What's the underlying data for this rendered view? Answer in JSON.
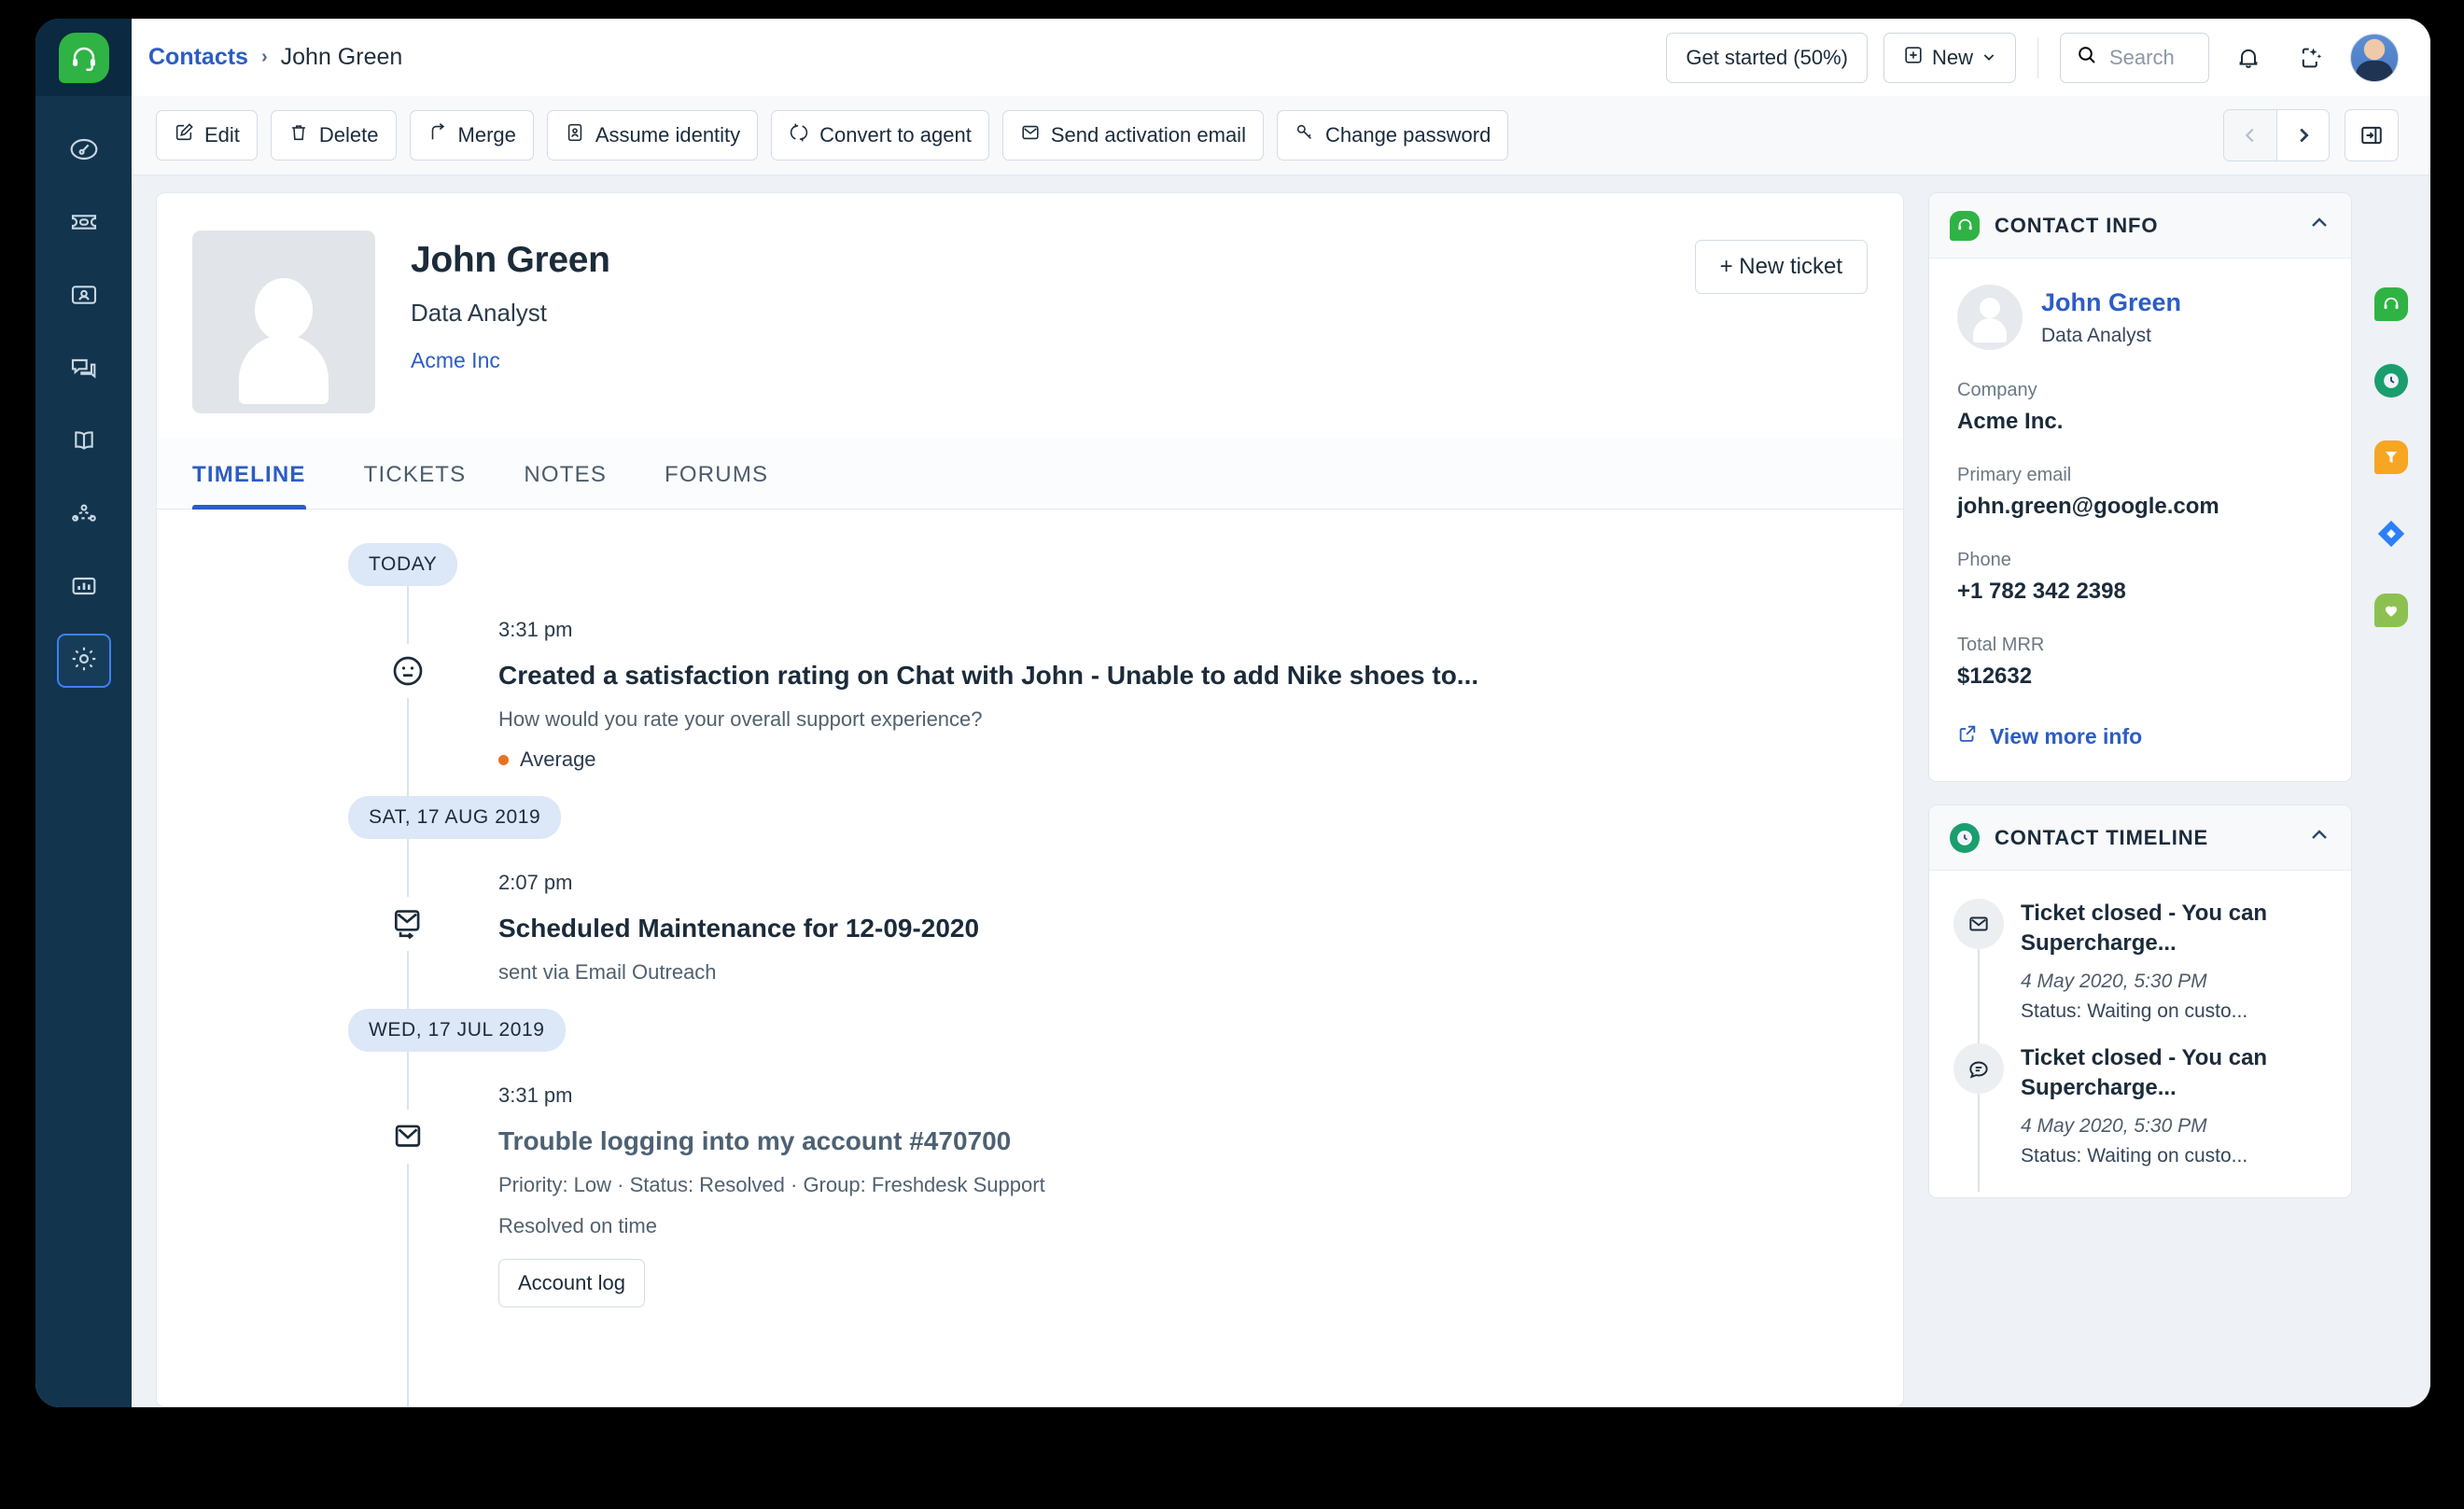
{
  "leftnav": {
    "logo_icon": "headset-icon",
    "items": [
      {
        "name": "dashboard",
        "icon": "speedometer-icon"
      },
      {
        "name": "tickets",
        "icon": "ticket-icon"
      },
      {
        "name": "contacts",
        "icon": "contact-card-icon"
      },
      {
        "name": "chat",
        "icon": "chat-bubbles-icon"
      },
      {
        "name": "solutions",
        "icon": "book-icon"
      },
      {
        "name": "automations",
        "icon": "nodes-icon"
      },
      {
        "name": "analytics",
        "icon": "bar-chart-icon"
      },
      {
        "name": "admin",
        "icon": "gear-icon",
        "active": true
      }
    ]
  },
  "header": {
    "breadcrumb_root": "Contacts",
    "breadcrumb_separator": "›",
    "breadcrumb_current": "John Green",
    "get_started_label": "Get started (50%)",
    "new_label": "New",
    "new_caret": "⌄",
    "search_placeholder": "Search",
    "notifications_icon": "bell-icon",
    "freddy_icon": "sparkle-icon",
    "avatar_icon": "user-avatar"
  },
  "toolbar": {
    "buttons": [
      {
        "label": "Edit",
        "icon": "pencil-square-icon"
      },
      {
        "label": "Delete",
        "icon": "trash-icon"
      },
      {
        "label": "Merge",
        "icon": "merge-arrow-icon"
      },
      {
        "label": "Assume identity",
        "icon": "id-badge-icon"
      },
      {
        "label": "Convert to agent",
        "icon": "refresh-icon"
      },
      {
        "label": "Send activation email",
        "icon": "envelope-check-icon"
      },
      {
        "label": "Change password",
        "icon": "key-icon"
      }
    ],
    "prev_arrow": "‹",
    "next_arrow": "›",
    "panel_toggle_icon": "panel-collapse-icon"
  },
  "contact": {
    "name": "John Green",
    "role": "Data Analyst",
    "company": "Acme Inc",
    "new_ticket_label": "+ New ticket"
  },
  "tabs": [
    {
      "label": "TIMELINE",
      "active": true
    },
    {
      "label": "TICKETS",
      "active": false
    },
    {
      "label": "NOTES",
      "active": false
    },
    {
      "label": "FORUMS",
      "active": false
    }
  ],
  "timeline": [
    {
      "date_pill": "TODAY",
      "entries": [
        {
          "time": "3:31 pm",
          "title": "Created a satisfaction rating on Chat with John - Unable to add Nike shoes to...",
          "icon": "neutral-face-icon",
          "subtitle": "How would you rate your overall support experience?",
          "rating": "Average",
          "rating_color": "#e8731e",
          "muted": false
        }
      ]
    },
    {
      "date_pill": "SAT, 17 AUG 2019",
      "entries": [
        {
          "time": "2:07 pm",
          "title": "Scheduled Maintenance for 12-09-2020",
          "icon": "envelope-outreach-icon",
          "subtitle": "sent via Email Outreach",
          "muted": false
        }
      ]
    },
    {
      "date_pill": "WED, 17 JUL 2019",
      "entries": [
        {
          "time": "3:31 pm",
          "title": "Trouble logging into my account #470700",
          "icon": "envelope-icon",
          "subtitle": "Priority: Low  ·  Status: Resolved  ·  Group: Freshdesk Support",
          "subtitle2": "Resolved on time",
          "tag": "Account log",
          "muted": true
        }
      ]
    }
  ],
  "contact_info": {
    "panel_title": "CONTACT INFO",
    "panel_icon": "headset-leaf-icon",
    "panel_color": "#2fb344",
    "collapse_icon": "chevron-up-icon",
    "name": "John Green",
    "role": "Data Analyst",
    "fields": [
      {
        "label": "Company",
        "value": "Acme Inc."
      },
      {
        "label": "Primary email",
        "value": "john.green@google.com"
      },
      {
        "label": "Phone",
        "value": "+1 782 342 2398"
      },
      {
        "label": "Total MRR",
        "value": "$12632"
      }
    ],
    "view_more_label": "View more info",
    "view_more_icon": "external-link-icon"
  },
  "contact_timeline": {
    "panel_title": "CONTACT TIMELINE",
    "panel_icon": "clock-icon",
    "panel_color": "#1a9e6e",
    "collapse_icon": "chevron-up-icon",
    "items": [
      {
        "title": "Ticket closed - You can Supercharge...",
        "date": "4 May 2020, 5:30 PM",
        "status": "Status: Waiting on custo...",
        "icon": "envelope-icon"
      },
      {
        "title": "Ticket closed - You can Supercharge...",
        "date": "4 May 2020, 5:30 PM",
        "status": "Status: Waiting on custo...",
        "icon": "chat-bubble-icon"
      }
    ]
  },
  "app_rail": [
    {
      "name": "freshdesk-app",
      "icon": "headset-icon",
      "color": "#2fb344",
      "shape": "leaf"
    },
    {
      "name": "time-tracking-app",
      "icon": "clock-icon",
      "color": "#1a9e6e",
      "shape": "circle"
    },
    {
      "name": "funnel-app",
      "icon": "funnel-icon",
      "color": "#f6a623",
      "shape": "leaf"
    },
    {
      "name": "jira-app",
      "icon": "diamond-icon",
      "color": "#2d7ff9",
      "shape": "diamond"
    },
    {
      "name": "health-app",
      "icon": "heart-icon",
      "color": "#8cc152",
      "shape": "leaf"
    }
  ]
}
